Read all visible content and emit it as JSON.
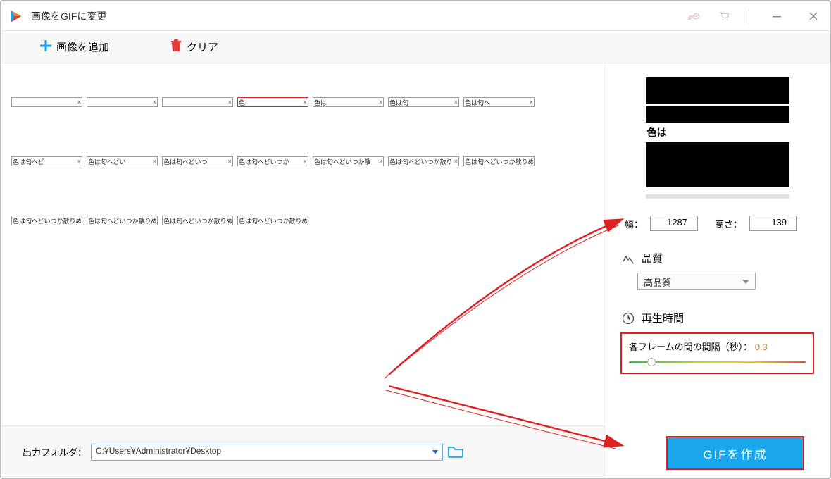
{
  "window": {
    "title": "画像をGIFに変更"
  },
  "toolbar": {
    "add_label": "画像を追加",
    "clear_label": "クリア"
  },
  "frames": {
    "selected_index": 3,
    "rows": [
      [
        "",
        "",
        "",
        "色",
        "色は",
        "色は匂",
        "色は匂へ"
      ],
      [
        "色は匂へど",
        "色は匂へどい",
        "色は匂へどいつ",
        "色は匂へどいつか",
        "色は匂へどいつか散",
        "色は匂へどいつか散り",
        "色は匂へどいつか散りぬ"
      ],
      [
        "色は匂へどいつか散りぬる",
        "色は匂へどいつか散りぬる",
        "色は匂へどいつか散りぬる",
        "色は匂へどいつか散りぬる"
      ]
    ]
  },
  "preview": {
    "caption": "色は"
  },
  "dimensions": {
    "width_label": "幅：",
    "width_value": "1287",
    "height_label": "高さ：",
    "height_value": "139"
  },
  "quality": {
    "title": "品質",
    "selected": "高品質"
  },
  "playback": {
    "title": "再生時間",
    "interval_label_prefix": "各フレームの間の間隔（秒）：",
    "interval_value": "0.3"
  },
  "output": {
    "label": "出力フォルダ：",
    "path": "C:¥Users¥Administrator¥Desktop"
  },
  "actions": {
    "create_gif": "GIFを作成"
  }
}
